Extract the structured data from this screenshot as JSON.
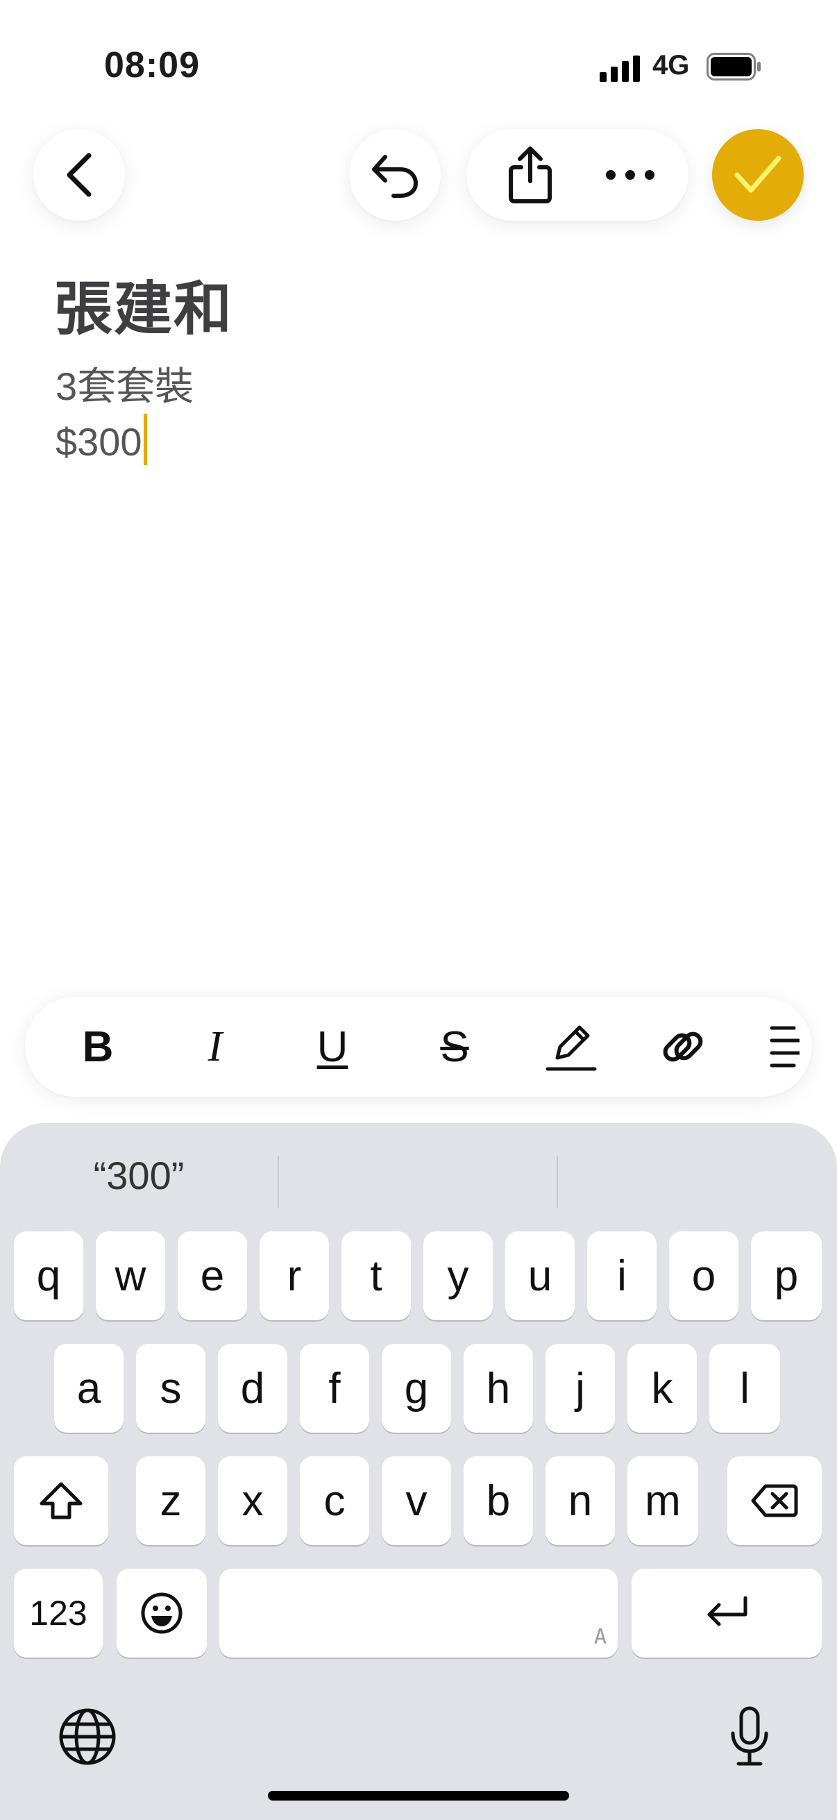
{
  "status_bar": {
    "time": "08:09",
    "network": "4G",
    "icons": [
      "signal-icon",
      "battery-icon"
    ]
  },
  "toolbar": {
    "icons": [
      "back-icon",
      "undo-icon",
      "share-icon",
      "more-icon",
      "checkmark-icon"
    ],
    "accent": "#e3ac09"
  },
  "note": {
    "title": "張建和",
    "lines": [
      "3套套裝",
      "$300"
    ]
  },
  "format_bar": {
    "bold": "B",
    "italic": "I",
    "underline": "U",
    "strikethrough": "S",
    "icons": [
      "pencil-icon",
      "link-icon",
      "align-icon"
    ]
  },
  "keyboard": {
    "suggestions": [
      "“300”",
      "",
      ""
    ],
    "row1": [
      "q",
      "w",
      "e",
      "r",
      "t",
      "y",
      "u",
      "i",
      "o",
      "p"
    ],
    "row2": [
      "a",
      "s",
      "d",
      "f",
      "g",
      "h",
      "j",
      "k",
      "l"
    ],
    "row3": [
      "z",
      "x",
      "c",
      "v",
      "b",
      "n",
      "m"
    ],
    "numbers_key": "123",
    "space_hint": "A",
    "icons": [
      "shift-icon",
      "delete-icon",
      "emoji-icon",
      "return-icon",
      "globe-icon",
      "microphone-icon"
    ],
    "background": "#e0e2e7"
  }
}
